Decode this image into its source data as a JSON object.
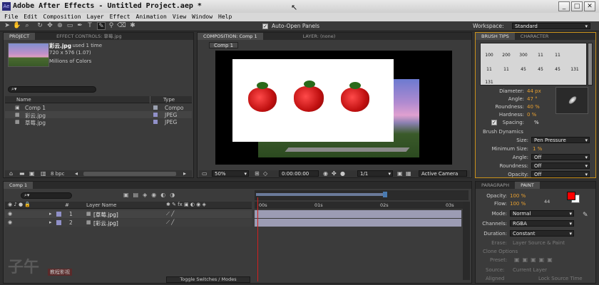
{
  "window": {
    "title": "Adobe After Effects - Untitled Project.aep *",
    "icon_label": "Ae"
  },
  "menu": [
    "File",
    "Edit",
    "Composition",
    "Layer",
    "Effect",
    "Animation",
    "View",
    "Window",
    "Help"
  ],
  "toolbar": {
    "auto_open_label": "Auto-Open Panels",
    "workspace_label": "Workspace:",
    "workspace_value": "Standard"
  },
  "project": {
    "tab_project": "PROJECT",
    "tab_effect_controls": "EFFECT CONTROLS: 草莓.jpg",
    "preview_name": "彩云.jpg",
    "preview_used": ", used 1 time",
    "preview_size": "720 x 576 (1.07)",
    "preview_color": "Millions of Colors",
    "col_name": "Name",
    "col_type": "Type",
    "items": [
      {
        "name": "Comp 1",
        "type": "Compo",
        "color": "#9aa0b0"
      },
      {
        "name": "彩云.jpg",
        "type": "JPEG",
        "color": "#9090c8"
      },
      {
        "name": "草莓.jpg",
        "type": "JPEG",
        "color": "#9090c8"
      }
    ],
    "bpc": "8 bpc"
  },
  "composition": {
    "tab_comp": "COMPOSITION: Comp 1",
    "tab_layer": "LAYER: (none)",
    "breadcrumb": "Comp 1",
    "zoom": "50%",
    "timecode": "0:00:00:00",
    "resolution": "1/1",
    "camera": "Active Camera"
  },
  "timeline": {
    "tab": "Comp 1",
    "col_layer_name": "Layer Name",
    "col_num": "#",
    "layers": [
      {
        "num": "1",
        "name": "[草莓.jpg]"
      },
      {
        "num": "2",
        "name": "[彩云.jpg]"
      }
    ],
    "ruler": [
      "00s",
      "01s",
      "02s",
      "03s"
    ],
    "toggle_label": "Toggle Switches / Modes"
  },
  "brush_tips": {
    "tab_brush": "BRUSH TIPS",
    "tab_character": "CHARACTER",
    "tips": [
      "100",
      "200",
      "300",
      "11",
      "11",
      "11",
      "11",
      "45",
      "45",
      "45",
      "131",
      "131"
    ],
    "diameter_label": "Diameter:",
    "diameter_value": "44 px",
    "angle_label": "Angle:",
    "angle_value": "47 °",
    "roundness_label": "Roundness:",
    "roundness_value": "40 %",
    "hardness_label": "Hardness:",
    "hardness_value": "0 %",
    "spacing_label": "Spacing:",
    "spacing_value": "%",
    "dynamics_label": "Brush Dynamics",
    "size_label": "Size:",
    "size_value": "Pen Pressure",
    "min_size_label": "Minimum Size:",
    "min_size_value": "1 %",
    "angle2_label": "Angle:",
    "angle2_value": "Off",
    "roundness2_label": "Roundness:",
    "roundness2_value": "Off",
    "opacity_label": "Opacity:",
    "opacity_value": "Off"
  },
  "paint": {
    "tab_paragraph": "PARAGRAPH",
    "tab_paint": "PAINT",
    "opacity_label": "Opacity:",
    "opacity_value": "100 %",
    "flow_label": "Flow:",
    "flow_value": "100 %",
    "brush_size": "44",
    "mode_label": "Mode:",
    "mode_value": "Normal",
    "channels_label": "Channels:",
    "channels_value": "RGBA",
    "duration_label": "Duration:",
    "duration_value": "Constant",
    "erase_label": "Erase:",
    "erase_value": "Layer Source & Paint",
    "clone_label": "Clone Options",
    "preset_label": "Preset:",
    "source_label": "Source:",
    "source_value": "Current Layer",
    "aligned_label": "Aligned",
    "lock_label": "Lock Source Time",
    "fg_color": "#ff0000",
    "bg_color": "#ffffff"
  },
  "watermark": {
    "glyph": "子午",
    "badge": "教程影视"
  },
  "colors": {
    "accent": "#e8a030",
    "timeline_bar": "#9c9cb4",
    "playhead": "#d02020"
  }
}
